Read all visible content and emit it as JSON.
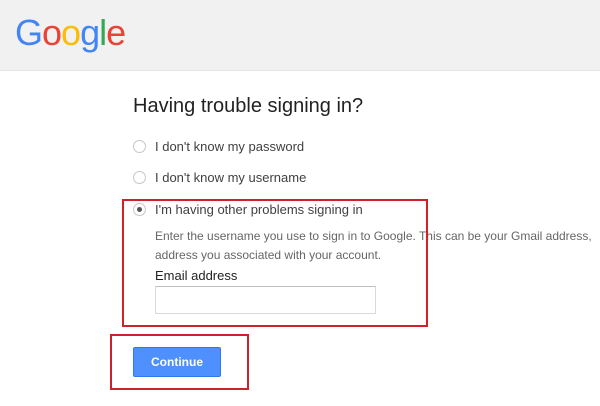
{
  "header": {
    "logo_letters": [
      {
        "char": "G",
        "color": "#4285f4"
      },
      {
        "char": "o",
        "color": "#ea4335"
      },
      {
        "char": "o",
        "color": "#fbbc05"
      },
      {
        "char": "g",
        "color": "#4285f4"
      },
      {
        "char": "l",
        "color": "#34a853"
      },
      {
        "char": "e",
        "color": "#ea4335"
      }
    ]
  },
  "main": {
    "title": "Having trouble signing in?",
    "options": [
      {
        "label": "I don't know my password",
        "selected": false
      },
      {
        "label": "I don't know my username",
        "selected": false
      },
      {
        "label": "I'm having other problems signing in",
        "selected": true
      }
    ],
    "description_line1": "Enter the username you use to sign in to Google. This can be your Gmail address,",
    "description_line2": "address you associated with your account.",
    "email_label": "Email address",
    "email_value": "",
    "continue_label": "Continue"
  },
  "colors": {
    "highlight": "#d0202a",
    "button": "#4d90fe"
  }
}
